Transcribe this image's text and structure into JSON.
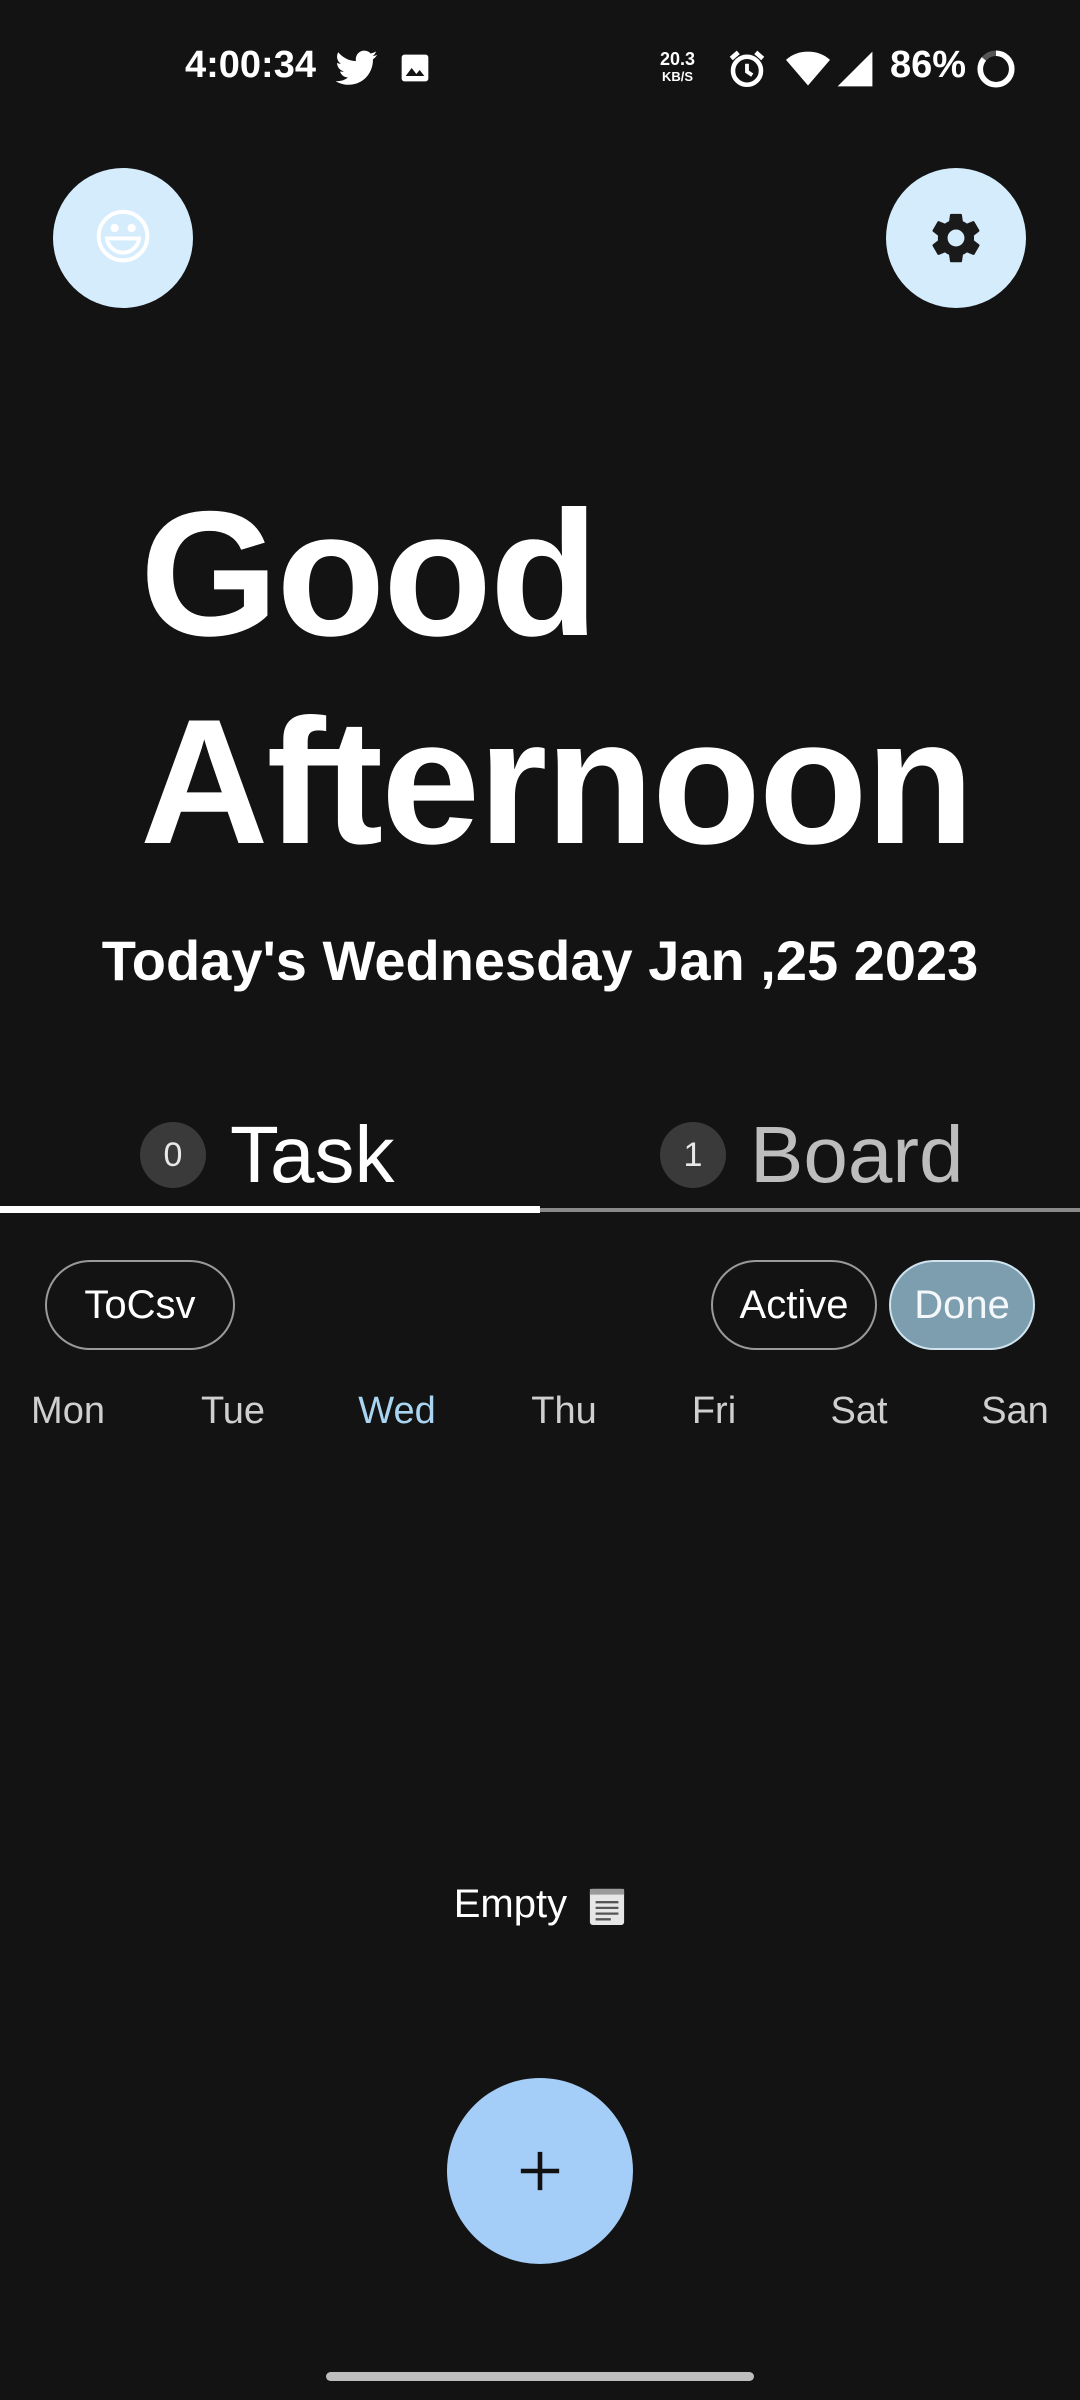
{
  "status_bar": {
    "time": "4:00:34",
    "net_speed_value": "20.3",
    "net_speed_unit": "KB/S",
    "battery": "86%",
    "icons": [
      "twitter-icon",
      "image-icon",
      "alarm-icon",
      "wifi-icon",
      "signal-icon",
      "battery-ring-icon"
    ]
  },
  "header": {
    "avatar_emoji": "😃",
    "settings_icon": "gear-icon"
  },
  "greeting": {
    "line1": "Good",
    "line2": "Afternoon",
    "date_text": "Today's Wednesday Jan ,25 2023"
  },
  "tabs": [
    {
      "count": "0",
      "label": "Task",
      "selected": true
    },
    {
      "count": "1",
      "label": "Board",
      "selected": false
    }
  ],
  "chips": {
    "export": "ToCsv",
    "active": "Active",
    "done": "Done",
    "selected": "Done"
  },
  "weekdays": {
    "items": [
      "Mon",
      "Tue",
      "Wed",
      "Thu",
      "Fri",
      "Sat",
      "San"
    ],
    "selected": "Wed"
  },
  "empty_state": {
    "text": "Empty",
    "icon": "notepad-icon"
  },
  "fab": {
    "icon": "plus-icon"
  },
  "colors": {
    "background": "#131313",
    "accent_light": "#d4ecfc",
    "fab": "#a4cdf7",
    "done_chip": "#7c9eae",
    "selected_day": "#a9d5f2"
  }
}
